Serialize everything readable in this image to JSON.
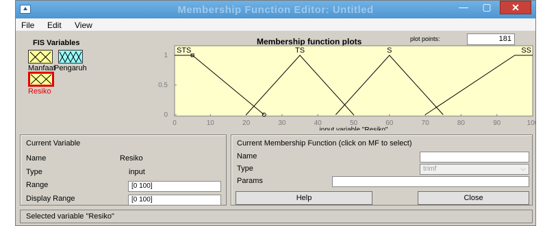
{
  "window": {
    "title": "Membership Function Editor: Untitled",
    "minimize": "—",
    "maximize": "▢",
    "close": "✕"
  },
  "menu": {
    "file": "File",
    "edit": "Edit",
    "view": "View"
  },
  "fis": {
    "heading": "FIS Variables",
    "variables": [
      {
        "label": "Manfaat",
        "color": "#ffff99",
        "selected": false
      },
      {
        "label": "Pengaruh",
        "color": "#99ffff",
        "selected": false
      },
      {
        "label": "Resiko",
        "color": "#ffff99",
        "selected": true
      }
    ]
  },
  "plot": {
    "heading": "Membership function plots",
    "points_label": "plot points:",
    "points_value": "181"
  },
  "chart_data": {
    "type": "line",
    "xlabel": "input variable \"Resiko\"",
    "xlim": [
      0,
      100
    ],
    "ylim": [
      0,
      1
    ],
    "xticks": [
      "0",
      "10",
      "20",
      "30",
      "40",
      "50",
      "60",
      "70",
      "80",
      "90",
      "100"
    ],
    "yticks": [
      "0",
      "0.5",
      "1"
    ],
    "series": [
      {
        "name": "STS",
        "x": [
          0,
          5,
          25
        ],
        "y": [
          1,
          1,
          0
        ]
      },
      {
        "name": "TS",
        "x": [
          20,
          35,
          50
        ],
        "y": [
          0,
          1,
          0
        ]
      },
      {
        "name": "S",
        "x": [
          45,
          60,
          75
        ],
        "y": [
          0,
          1,
          0
        ]
      },
      {
        "name": "SS",
        "x": [
          70,
          95,
          100
        ],
        "y": [
          0,
          1,
          1
        ]
      }
    ],
    "background": "#ffffcc"
  },
  "current_variable": {
    "heading": "Current Variable",
    "name_label": "Name",
    "name_value": "Resiko",
    "type_label": "Type",
    "type_value": "input",
    "range_label": "Range",
    "range_value": "[0 100]",
    "display_range_label": "Display Range",
    "display_range_value": "[0 100]"
  },
  "current_mf": {
    "heading": "Current Membership Function (click on MF to select)",
    "name_label": "Name",
    "name_value": "",
    "type_label": "Type",
    "type_value": "trimf",
    "params_label": "Params",
    "params_value": ""
  },
  "buttons": {
    "help": "Help",
    "close": "Close"
  },
  "status": "Selected variable \"Resiko\""
}
